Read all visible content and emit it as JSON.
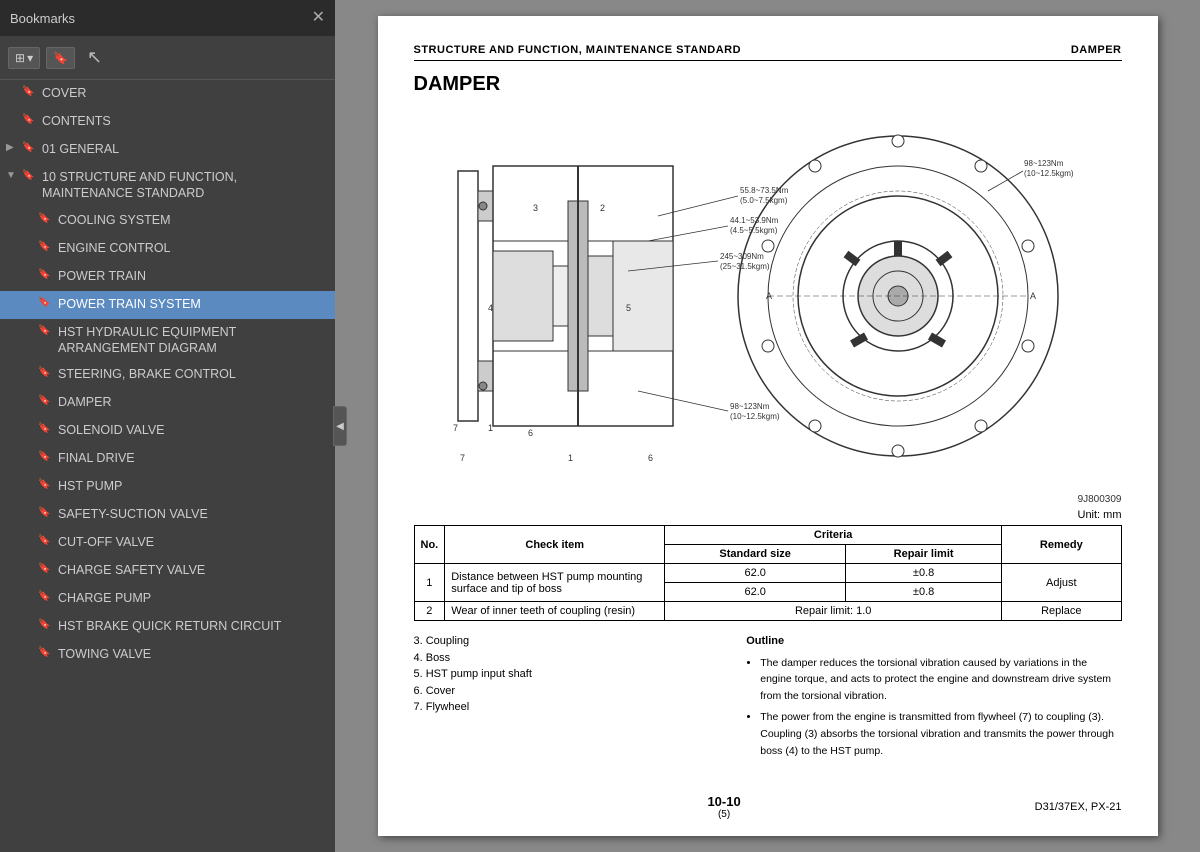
{
  "sidebar": {
    "title": "Bookmarks",
    "close_label": "✕",
    "toolbar": {
      "view_btn": "☰▾",
      "bookmark_btn": "🔖"
    },
    "items": [
      {
        "id": "cover",
        "label": "COVER",
        "indent": 0,
        "arrow": "none",
        "active": false
      },
      {
        "id": "contents",
        "label": "CONTENTS",
        "indent": 0,
        "arrow": "none",
        "active": false
      },
      {
        "id": "general",
        "label": "01 GENERAL",
        "indent": 0,
        "arrow": "right",
        "active": false
      },
      {
        "id": "structure",
        "label": "10 STRUCTURE AND FUNCTION, MAINTENANCE STANDARD",
        "indent": 0,
        "arrow": "down",
        "active": false
      },
      {
        "id": "cooling",
        "label": "COOLING SYSTEM",
        "indent": 1,
        "arrow": "none",
        "active": false
      },
      {
        "id": "engine-control",
        "label": "ENGINE CONTROL",
        "indent": 1,
        "arrow": "none",
        "active": false
      },
      {
        "id": "power-train",
        "label": "POWER TRAIN",
        "indent": 1,
        "arrow": "none",
        "active": false
      },
      {
        "id": "power-train-system",
        "label": "POWER TRAIN SYSTEM",
        "indent": 1,
        "arrow": "none",
        "active": true
      },
      {
        "id": "hst-hydraulic",
        "label": "HST HYDRAULIC EQUIPMENT ARRANGEMENT DIAGRAM",
        "indent": 1,
        "arrow": "none",
        "active": false
      },
      {
        "id": "steering",
        "label": "STEERING, BRAKE CONTROL",
        "indent": 1,
        "arrow": "none",
        "active": false
      },
      {
        "id": "damper",
        "label": "DAMPER",
        "indent": 1,
        "arrow": "none",
        "active": false
      },
      {
        "id": "solenoid",
        "label": "SOLENOID VALVE",
        "indent": 1,
        "arrow": "none",
        "active": false
      },
      {
        "id": "final-drive",
        "label": "FINAL DRIVE",
        "indent": 1,
        "arrow": "none",
        "active": false
      },
      {
        "id": "hst-pump",
        "label": "HST PUMP",
        "indent": 1,
        "arrow": "none",
        "active": false
      },
      {
        "id": "safety-suction",
        "label": "SAFETY-SUCTION VALVE",
        "indent": 1,
        "arrow": "none",
        "active": false
      },
      {
        "id": "cut-off",
        "label": "CUT-OFF VALVE",
        "indent": 1,
        "arrow": "none",
        "active": false
      },
      {
        "id": "charge-safety",
        "label": "CHARGE SAFETY VALVE",
        "indent": 1,
        "arrow": "none",
        "active": false
      },
      {
        "id": "charge-pump",
        "label": "CHARGE PUMP",
        "indent": 1,
        "arrow": "none",
        "active": false
      },
      {
        "id": "hst-brake",
        "label": "HST BRAKE QUICK RETURN CIRCUIT",
        "indent": 1,
        "arrow": "none",
        "active": false
      },
      {
        "id": "towing",
        "label": "TOWING VALVE",
        "indent": 1,
        "arrow": "none",
        "active": false
      }
    ]
  },
  "main": {
    "header_left": "STRUCTURE AND FUNCTION, MAINTENANCE STANDARD",
    "header_right": "DAMPER",
    "page_title": "DAMPER",
    "figure_number": "9J800309",
    "unit_label": "Unit: mm",
    "table": {
      "headers": [
        "No.",
        "Check item",
        "Criteria",
        "",
        "Remedy"
      ],
      "criteria_sub": [
        "Standard size",
        "Repair limit"
      ],
      "rows": [
        {
          "no": "1",
          "check_item": "Distance between HST pump mounting surface and tip of boss",
          "standard_size": "62.0",
          "repair_limit": "±0.8",
          "remedy": "Adjust"
        },
        {
          "no": "2",
          "check_item": "Wear of inner teeth of coupling (resin)",
          "standard_size": "Repair limit: 1.0",
          "repair_limit": "",
          "remedy": "Replace"
        }
      ]
    },
    "bottom_left": {
      "items": [
        "3. Coupling",
        "4. Boss",
        "5. HST pump input shaft",
        "6. Cover",
        "7. Flywheel"
      ]
    },
    "bottom_right": {
      "title": "Outline",
      "bullets": [
        "The damper reduces the torsional vibration caused by variations in the engine torque, and acts to protect the engine and downstream drive system from the torsional vibration.",
        "The power from the engine is transmitted from flywheel (7) to coupling (3). Coupling (3) absorbs the torsional vibration and transmits the power through boss (4) to the HST pump."
      ]
    },
    "page_number_main": "10-10",
    "page_number_sub": "(5)",
    "footer_right": "D31/37EX, PX-21"
  },
  "annotations": {
    "torque1": "55.8~73.5Nm\n(5.0~7.5kgm)",
    "torque2": "44.1~53.9Nm\n(4.5~5.5kgm)",
    "torque3": "245~309Nm\n(25~31.5kgm)",
    "torque4": "98~123Nm\n(10~12.5kgm)",
    "torque5": "98~123Nm\n(10~12.5kgm)",
    "label_a": "A",
    "label_a2": "A",
    "nums": [
      "1",
      "2",
      "3",
      "4",
      "5",
      "6",
      "7"
    ]
  }
}
